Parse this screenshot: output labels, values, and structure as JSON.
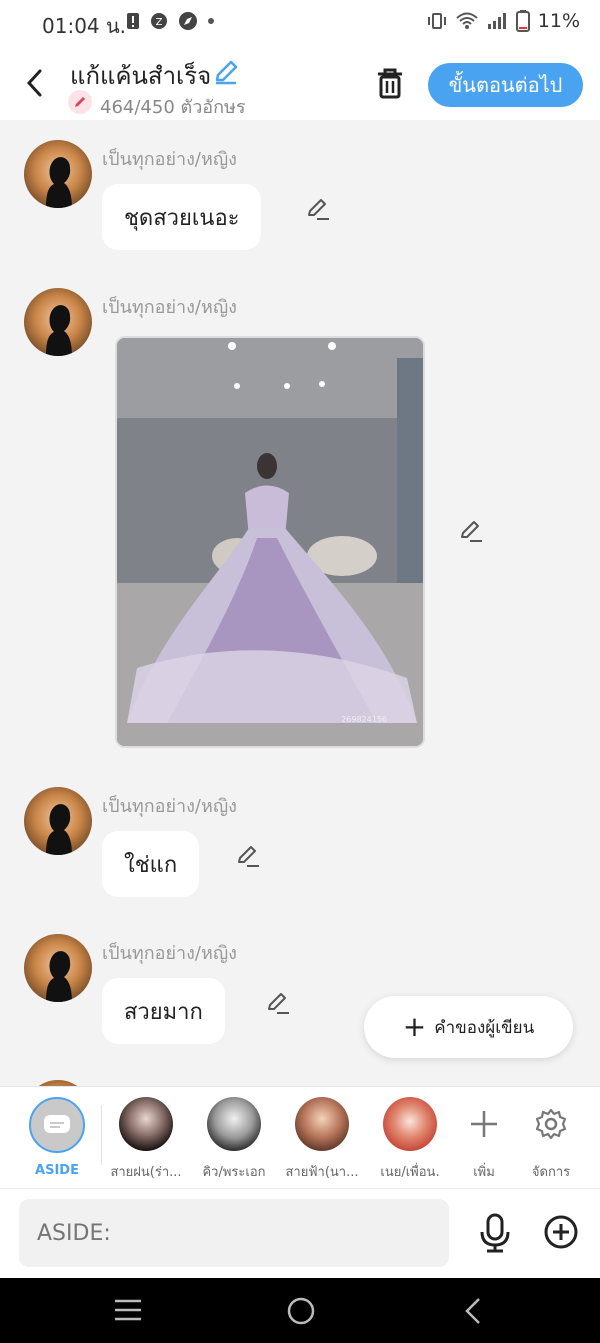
{
  "status": {
    "time": "01:04 น.",
    "battery": "11%"
  },
  "header": {
    "title": "แก้แค้นสำเร็จ",
    "counter": "464/450 ตัวอักษร",
    "next_label": "ขั้นตอนต่อไป"
  },
  "messages": [
    {
      "sender": "เป็นทุกอย่าง/หญิง",
      "text": "ชุดสวยเนอะ"
    },
    {
      "sender": "เป็นทุกอย่าง/หญิง",
      "image_watermark": "269824156"
    },
    {
      "sender": "เป็นทุกอย่าง/หญิง",
      "text": "ใช่แก"
    },
    {
      "sender": "เป็นทุกอย่าง/หญิง",
      "text": "สวยมาก"
    }
  ],
  "fab": {
    "label": "คำของผู้เขียน"
  },
  "characters": [
    {
      "label": "ASIDE"
    },
    {
      "label": "สายฝน(ร่า..."
    },
    {
      "label": "คิว/พระเอก"
    },
    {
      "label": "สายฟ้า(นา..."
    },
    {
      "label": "เนย/เพื่อน."
    },
    {
      "label": "เพิ่ม"
    },
    {
      "label": "จัดการ"
    }
  ],
  "input": {
    "placeholder": "ASIDE:"
  },
  "colors": {
    "accent": "#4aa3f0",
    "background": "#f3f3f3"
  }
}
